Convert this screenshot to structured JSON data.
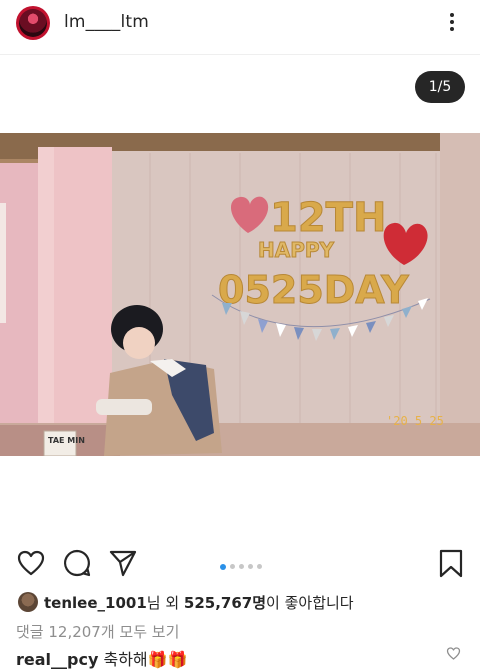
{
  "post": {
    "username": "lm____ltm",
    "counter": "1/5",
    "photo": {
      "balloon_title": "12TH",
      "balloon_sub": "HAPPY",
      "balloon_day": "0525DAY",
      "date_stamp": "'20  5 25",
      "sign": "TAE MIN"
    }
  },
  "actions": {
    "like_icon": "heart-outline-icon",
    "comment_icon": "speech-bubble-icon",
    "share_icon": "paper-plane-icon",
    "save_icon": "bookmark-icon",
    "carousel_total": 5,
    "carousel_active": 1
  },
  "likes": {
    "user": "tenlee_1001",
    "mid": "님 외 ",
    "count": "525,767명",
    "tail": "이 좋아합니다"
  },
  "comments": {
    "view_all": "댓글 12,207개 모두 보기",
    "first_user": "real__pcy",
    "first_text": " 축하해🎁🎁"
  },
  "colors": {
    "counter_bg": "#262626",
    "carousel_active": "#2a90e8",
    "muted": "#8e8e8e"
  }
}
